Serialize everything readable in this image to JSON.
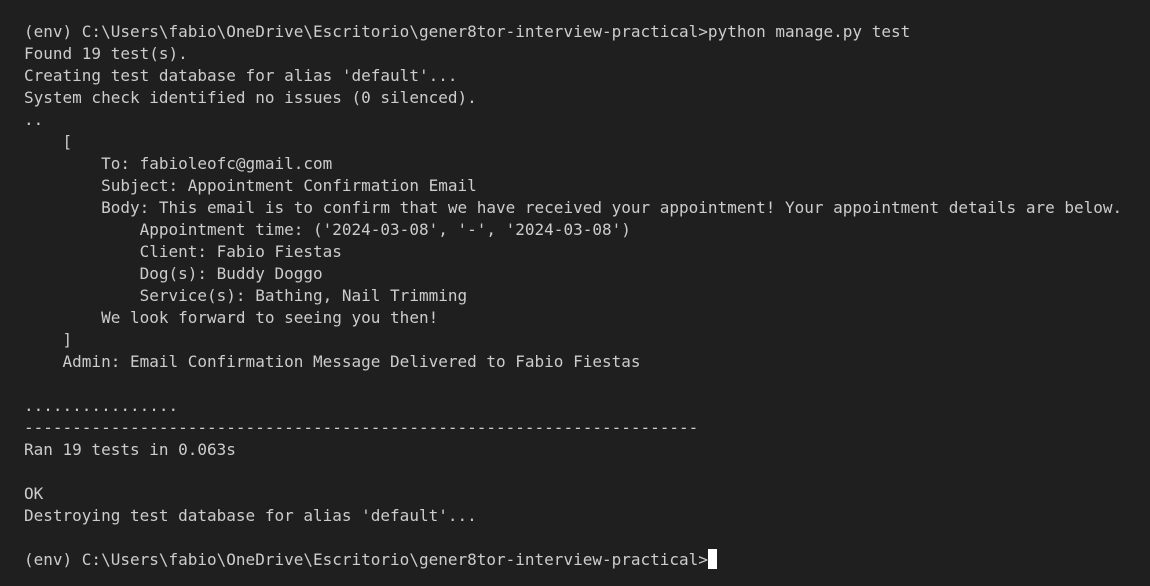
{
  "terminal": {
    "lines": [
      "(env) C:\\Users\\fabio\\OneDrive\\Escritorio\\gener8tor-interview-practical>python manage.py test",
      "Found 19 test(s).",
      "Creating test database for alias 'default'...",
      "System check identified no issues (0 silenced).",
      "..",
      "    [",
      "        To: fabioleofc@gmail.com",
      "        Subject: Appointment Confirmation Email",
      "        Body: This email is to confirm that we have received your appointment! Your appointment details are below.",
      "            Appointment time: ('2024-03-08', '-', '2024-03-08')",
      "            Client: Fabio Fiestas",
      "            Dog(s): Buddy Doggo",
      "            Service(s): Bathing, Nail Trimming",
      "        We look forward to seeing you then!",
      "    ]",
      "    Admin: Email Confirmation Message Delivered to Fabio Fiestas",
      "",
      "................",
      "----------------------------------------------------------------------",
      "Ran 19 tests in 0.063s",
      "",
      "OK",
      "Destroying test database for alias 'default'...",
      "",
      "(env) C:\\Users\\fabio\\OneDrive\\Escritorio\\gener8tor-interview-practical>"
    ]
  },
  "colors": {
    "background": "#1f1f1f",
    "text": "#cccccc",
    "cursor": "#ffffff"
  }
}
